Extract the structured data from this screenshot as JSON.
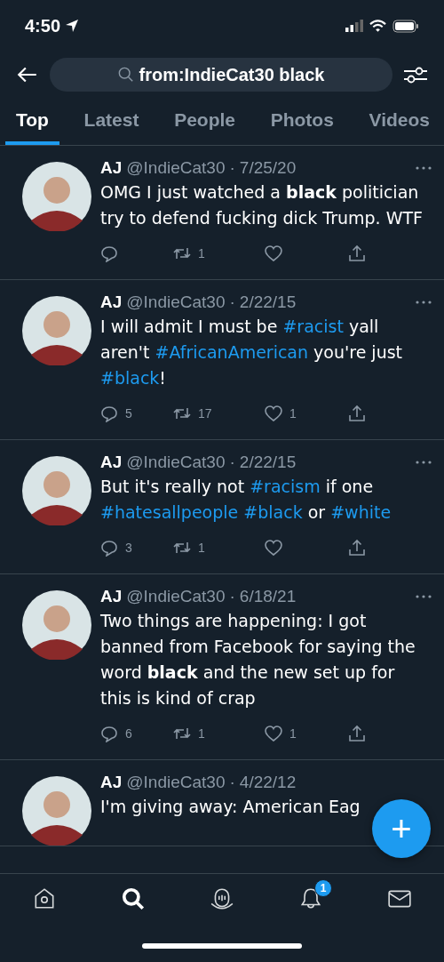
{
  "status_bar": {
    "time": "4:50"
  },
  "search": {
    "query": "from:IndieCat30 black"
  },
  "tabs": [
    {
      "label": "Top",
      "selected": true
    },
    {
      "label": "Latest",
      "selected": false
    },
    {
      "label": "People",
      "selected": false
    },
    {
      "label": "Photos",
      "selected": false
    },
    {
      "label": "Videos",
      "selected": false
    }
  ],
  "tweets": [
    {
      "author": "AJ",
      "handle": "@IndieCat30",
      "separator": "·",
      "date": "7/25/20",
      "text": [
        {
          "kind": "text",
          "text": "OMG I just watched a **black** politician try to defend fucking dick Trump. WTF"
        }
      ],
      "actions": [
        {
          "kind": "reply"
        },
        {
          "kind": "retweet",
          "count": "1"
        },
        {
          "kind": "like"
        },
        {
          "kind": "share"
        }
      ]
    },
    {
      "author": "AJ",
      "handle": "@IndieCat30",
      "separator": "·",
      "date": "2/22/15",
      "text": [
        {
          "kind": "text",
          "text": "I will admit I must be "
        },
        {
          "kind": "hashtag",
          "text": "#racist"
        },
        {
          "kind": "text",
          "text": " yall aren't "
        },
        {
          "kind": "hashtag",
          "text": "#AfricanAmerican"
        },
        {
          "kind": "text",
          "text": " you're just "
        },
        {
          "kind": "hashtag",
          "text": "#black"
        },
        {
          "kind": "text",
          "text": "!"
        }
      ],
      "actions": [
        {
          "kind": "reply",
          "count": "5"
        },
        {
          "kind": "retweet",
          "count": "17"
        },
        {
          "kind": "like",
          "count": "1"
        },
        {
          "kind": "share"
        }
      ]
    },
    {
      "author": "AJ",
      "handle": "@IndieCat30",
      "separator": "·",
      "date": "2/22/15",
      "text": [
        {
          "kind": "text",
          "text": "But it's really not "
        },
        {
          "kind": "hashtag",
          "text": "#racism"
        },
        {
          "kind": "text",
          "text": " if one "
        },
        {
          "kind": "hashtag",
          "text": "#hatesallpeople"
        },
        {
          "kind": "hashtag",
          "text": "#black"
        },
        {
          "kind": "text",
          "text": " or "
        },
        {
          "kind": "hashtag",
          "text": "#white"
        }
      ],
      "actions": [
        {
          "kind": "reply",
          "count": "3"
        },
        {
          "kind": "retweet",
          "count": "1"
        },
        {
          "kind": "like"
        },
        {
          "kind": "share"
        }
      ]
    },
    {
      "author": "AJ",
      "handle": "@IndieCat30",
      "separator": "·",
      "date": "6/18/21",
      "text": [
        {
          "kind": "text",
          "text": "Two things are happening: I got banned from Facebook for saying the word **black** and the new set up for this is kind of crap"
        }
      ],
      "actions": [
        {
          "kind": "reply",
          "count": "6"
        },
        {
          "kind": "retweet",
          "count": "1"
        },
        {
          "kind": "like",
          "count": "1"
        },
        {
          "kind": "share"
        }
      ]
    },
    {
      "author": "AJ",
      "handle": "@IndieCat30",
      "separator": "·",
      "date": "4/22/12",
      "text": [
        {
          "kind": "text",
          "text": "I'm giving away: American Eag"
        }
      ]
    }
  ],
  "fab": {
    "label": "+"
  },
  "bottom_nav": [
    {
      "kind": "home",
      "selected": false
    },
    {
      "kind": "search",
      "selected": true
    },
    {
      "kind": "spaces",
      "selected": false
    },
    {
      "kind": "notifications",
      "selected": false,
      "badge": "1"
    },
    {
      "kind": "messages",
      "selected": false
    }
  ]
}
